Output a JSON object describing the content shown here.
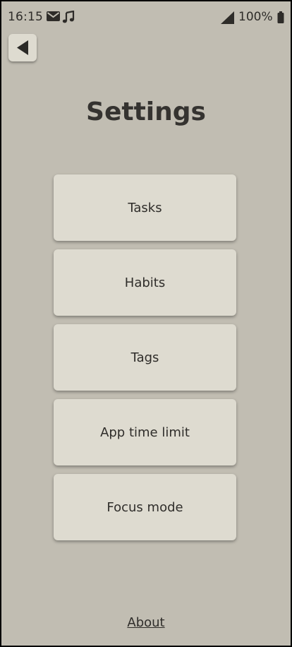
{
  "status_bar": {
    "time": "16:15",
    "battery": "100%",
    "icons": [
      "mail-icon",
      "music-note-icon",
      "signal-icon",
      "battery-icon"
    ]
  },
  "header": {
    "back_icon": "back-arrow-icon",
    "title": "Settings"
  },
  "menu": {
    "items": [
      {
        "label": "Tasks"
      },
      {
        "label": "Habits"
      },
      {
        "label": "Tags"
      },
      {
        "label": "App time limit"
      },
      {
        "label": "Focus mode"
      }
    ]
  },
  "footer": {
    "about_label": "About"
  },
  "colors": {
    "background": "#c1bdb2",
    "card": "#dedbd0",
    "text": "#2f2d2a"
  }
}
